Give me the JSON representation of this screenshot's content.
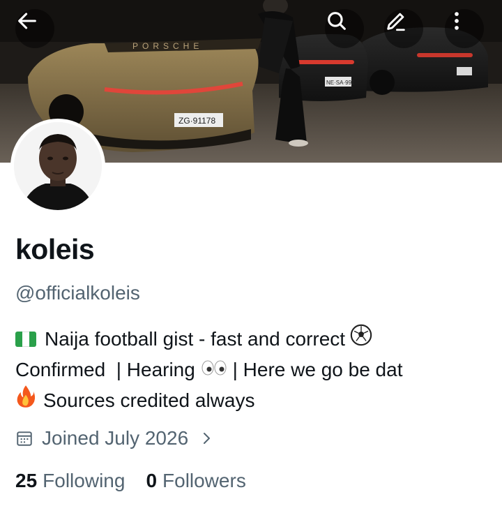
{
  "profile": {
    "name": "koleis",
    "handle": "@officialkoleis",
    "bio": {
      "line1_text": "Naija football gist - fast and correct",
      "line2_text": "Confirmed  | Hearing",
      "line2_after": " | Here we go be dat",
      "line3_text": "Sources credited always"
    },
    "joined": "Joined July 2026",
    "following_count": "25",
    "following_label": "Following",
    "followers_count": "0",
    "followers_label": "Followers"
  },
  "banner": {
    "plate_left": "ZG·91178",
    "plate_mid": "NE·SA·992",
    "brand": "PORSCHE"
  },
  "icons": {
    "back": "back-arrow-icon",
    "search": "search-icon",
    "edit": "edit-pencil-icon",
    "more": "more-vertical-icon",
    "calendar": "calendar-icon",
    "chevron": "chevron-right-icon"
  },
  "colors": {
    "text_primary": "#0f1419",
    "text_secondary": "#536471",
    "car_gold": "#8a7446",
    "tail_light": "#d83a2e"
  }
}
